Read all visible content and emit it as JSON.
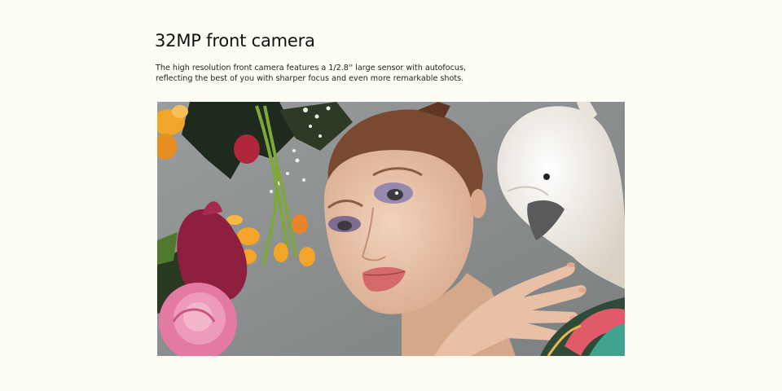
{
  "feature": {
    "title": "32MP front camera",
    "description_lines": [
      "The high resolution front camera features a 1/2.8'' large sensor with autofocus,",
      "reflecting the best of you with sharper focus and even more remarkable shots."
    ]
  },
  "photo": {
    "subject": "portrait-woman-with-cockatoo-and-flowers",
    "colors": {
      "backdrop": "#8c8f90",
      "skin": "#e7c2a8",
      "cockatoo": "#f1ece4",
      "rose_pink": "#e27aa2",
      "orchid_crimson": "#8e1f3e",
      "flower_orange": "#f0a52b"
    }
  }
}
